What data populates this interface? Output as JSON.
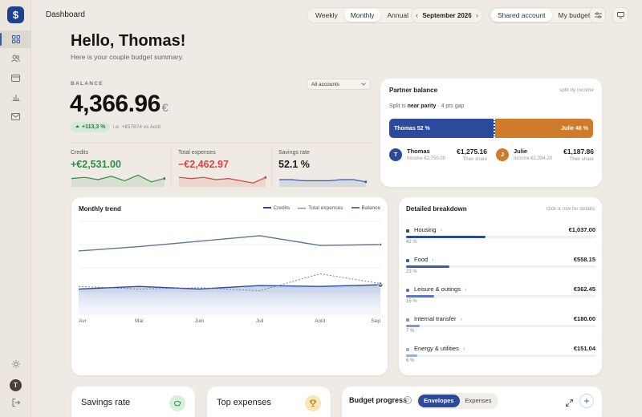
{
  "app": {
    "logo_glyph": "$",
    "page_title": "Dashboard"
  },
  "nav": {
    "items": [
      {
        "name": "dashboard-icon",
        "active": true
      },
      {
        "name": "users-icon",
        "active": false
      },
      {
        "name": "card-icon",
        "active": false
      },
      {
        "name": "bar-chart-icon",
        "active": false
      },
      {
        "name": "mail-icon",
        "active": false
      }
    ],
    "bottom": [
      "sun-icon",
      "logout-icon"
    ],
    "user_initial": "T"
  },
  "topbar": {
    "period_tabs": [
      "Weekly",
      "Monthly",
      "Annual"
    ],
    "period_selected": "Monthly",
    "month": "September 2026",
    "view_tabs": [
      "Shared account",
      "My budget"
    ],
    "view_selected": "Shared account"
  },
  "greeting": {
    "title": "Hello, Thomas!",
    "subtitle": "Here is your couple budget summary."
  },
  "balance": {
    "label": "BALANCE",
    "account_filter": "All accounts",
    "value": "4,366.96",
    "currency": "€",
    "change": "+113,3 %",
    "change_note": "i.e. +€57874 vs Août"
  },
  "kpis": [
    {
      "label": "Credits",
      "value": "+€2,531.00",
      "color": "#2f8a4a",
      "spark": [
        6,
        7,
        5,
        8,
        4,
        9,
        3,
        6
      ]
    },
    {
      "label": "Total expenses",
      "value": "−€2,462.97",
      "color": "#d64545",
      "spark": [
        7,
        6,
        7,
        5,
        6,
        4,
        2,
        7
      ]
    },
    {
      "label": "Savings rate",
      "value": "52.1 %",
      "color": "#3557b0",
      "spark": [
        5,
        5,
        4,
        4,
        4,
        5,
        5,
        3
      ]
    }
  ],
  "partner_balance": {
    "title": "Partner balance",
    "mode": "split by income",
    "split_prefix": "Split is ",
    "split_strong": "near parity",
    "split_suffix": " · 4 pts gap",
    "partners": [
      {
        "initial": "T",
        "name": "Thomas",
        "share_label": "Thomas 52 %",
        "share": 52,
        "income": "Income €2,750.00",
        "amount": "€1,275.16",
        "amount_note": "Their share",
        "color": "#2c4a9c"
      },
      {
        "initial": "J",
        "name": "Julie",
        "share_label": "Julie 48 %",
        "share": 48,
        "income": "Income €2,394.20",
        "amount": "€1,187.86",
        "amount_note": "Their share",
        "color": "#d07a2b"
      }
    ]
  },
  "chart_data": {
    "type": "line",
    "title": "Monthly trend",
    "categories": [
      "Avr",
      "Mai",
      "Juin",
      "Juil",
      "Août",
      "Sep"
    ],
    "series": [
      {
        "name": "Credits",
        "values": [
          2300,
          2360,
          2300,
          2380,
          2360,
          2400
        ],
        "color": "#2c4a9c"
      },
      {
        "name": "Total expenses",
        "values": [
          2360,
          2300,
          2330,
          2260,
          2660,
          2430
        ],
        "color": "#777777"
      },
      {
        "name": "Balance",
        "values": [
          3200,
          3300,
          3430,
          3560,
          3330,
          3350
        ],
        "color": "#5b7698"
      }
    ],
    "ylim": [
      1700,
      3900
    ],
    "grid": true,
    "legend": "top-right"
  },
  "breakdown": {
    "title": "Detailed breakdown",
    "hint": "click a row for details",
    "rows": [
      {
        "name": "Housing",
        "amount": "€1,037.00",
        "pct_label": "42 %",
        "pct": 42,
        "color": "#2c4a9c"
      },
      {
        "name": "Food",
        "amount": "€558.15",
        "pct_label": "23 %",
        "pct": 23,
        "color": "#3b5bb0"
      },
      {
        "name": "Leisure & outings",
        "amount": "€362.45",
        "pct_label": "15 %",
        "pct": 15,
        "color": "#5a76c0"
      },
      {
        "name": "Internal transfer",
        "amount": "€180.00",
        "pct_label": "7 %",
        "pct": 7,
        "color": "#8196cc"
      },
      {
        "name": "Energy & utilities",
        "amount": "€151.04",
        "pct_label": "6 %",
        "pct": 6,
        "color": "#9dafd8"
      }
    ]
  },
  "bottom": {
    "savings_title": "Savings rate",
    "top_expenses_title": "Top expenses",
    "budget_title": "Budget progress",
    "budget_tabs": [
      "Envelopes",
      "Expenses"
    ],
    "budget_selected": "Envelopes"
  }
}
